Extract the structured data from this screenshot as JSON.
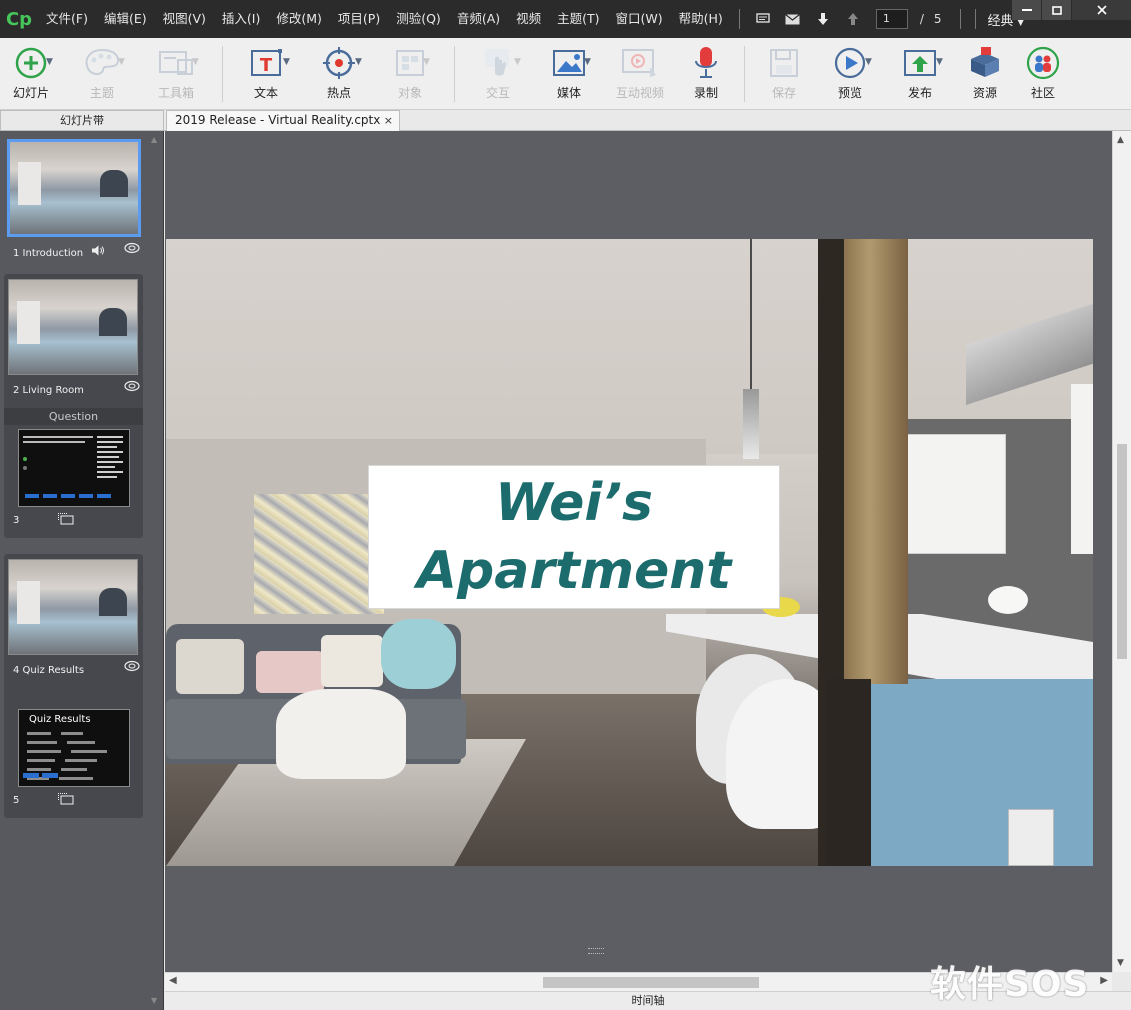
{
  "app": {
    "logo": "Cp"
  },
  "menu": [
    "文件(F)",
    "编辑(E)",
    "视图(V)",
    "插入(I)",
    "修改(M)",
    "项目(P)",
    "测验(Q)",
    "音频(A)",
    "视频",
    "主题(T)",
    "窗口(W)",
    "帮助(H)"
  ],
  "pager": {
    "current": "1",
    "separator": "/",
    "total": "5"
  },
  "mode": "经典",
  "toolbar": [
    {
      "label": "幻灯片",
      "icon": "add-slide-icon",
      "enabled": true
    },
    {
      "label": "主题",
      "icon": "palette-icon",
      "enabled": false
    },
    {
      "label": "工具箱",
      "icon": "toolbox-icon",
      "enabled": false
    },
    {
      "label": "文本",
      "icon": "text-icon",
      "enabled": true
    },
    {
      "label": "热点",
      "icon": "hotspot-icon",
      "enabled": true
    },
    {
      "label": "对象",
      "icon": "object-icon",
      "enabled": false
    },
    {
      "label": "交互",
      "icon": "interaction-icon",
      "enabled": false
    },
    {
      "label": "媒体",
      "icon": "media-icon",
      "enabled": true
    },
    {
      "label": "互动视频",
      "icon": "interactive-video-icon",
      "enabled": false
    },
    {
      "label": "录制",
      "icon": "microphone-icon",
      "enabled": true
    },
    {
      "label": "保存",
      "icon": "save-icon",
      "enabled": false
    },
    {
      "label": "预览",
      "icon": "preview-icon",
      "enabled": true
    },
    {
      "label": "发布",
      "icon": "publish-icon",
      "enabled": true
    },
    {
      "label": "资源",
      "icon": "assets-icon",
      "enabled": true
    },
    {
      "label": "社区",
      "icon": "community-icon",
      "enabled": true
    }
  ],
  "filmstrip": {
    "header": "幻灯片带",
    "question_group_label": "Question",
    "slides": [
      {
        "label": "1 Introduction",
        "selected": true
      },
      {
        "label": "2 Living Room",
        "selected": false
      },
      {
        "label": "3",
        "selected": false
      },
      {
        "label": "4 Quiz Results",
        "selected": false
      },
      {
        "label": "5",
        "selected": false
      }
    ],
    "quiz_results_thumb_title": "Quiz Results"
  },
  "document_tab": {
    "title": "2019 Release - Virtual Reality.cptx",
    "close": "×"
  },
  "slide": {
    "title_line1": "Wei’s",
    "title_line2": "Apartment"
  },
  "timeline_label": "时间轴",
  "watermark": "软件SOS",
  "colors": {
    "accent": "#5b9bf0",
    "title_text": "#1c6b6d",
    "stage": "#5c5e63",
    "filmstrip": "#57595f"
  }
}
